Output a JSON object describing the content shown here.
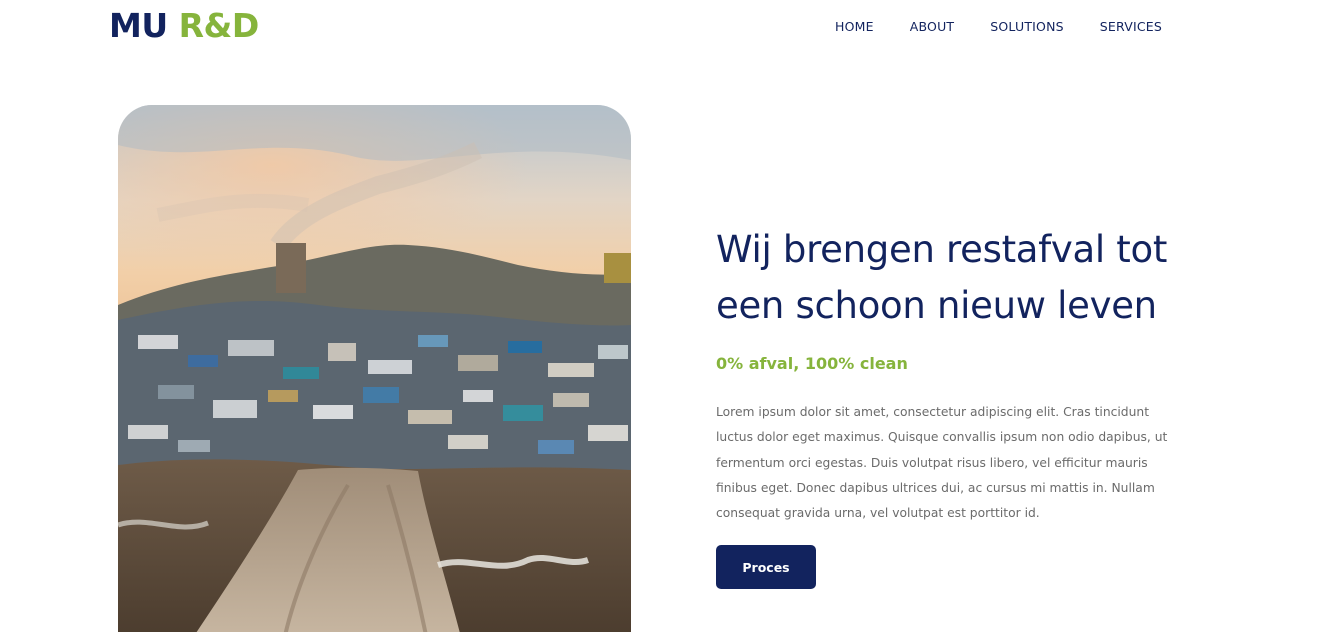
{
  "brand": {
    "part1": "MU",
    "part2": "R&D",
    "colors": {
      "primary": "#12235e",
      "accent": "#86b43c"
    }
  },
  "nav": {
    "items": [
      {
        "label": "HOME"
      },
      {
        "label": "ABOUT"
      },
      {
        "label": "SOLUTIONS"
      },
      {
        "label": "SERVICES"
      }
    ]
  },
  "hero": {
    "image_subject": "landfill-waste-photo",
    "headline": "Wij brengen restafval tot een schoon nieuw leven",
    "tagline": "0% afval, 100% clean",
    "body": "Lorem ipsum dolor sit amet, consectetur adipiscing elit. Cras tincidunt luctus dolor eget maximus. Quisque convallis ipsum non odio dapibus, ut fermentum orci egestas. Duis volutpat risus libero, vel efficitur mauris finibus eget. Donec dapibus ultrices dui, ac cursus mi mattis in. Nullam consequat gravida urna, vel volutpat est porttitor id.",
    "button_label": "Proces"
  }
}
